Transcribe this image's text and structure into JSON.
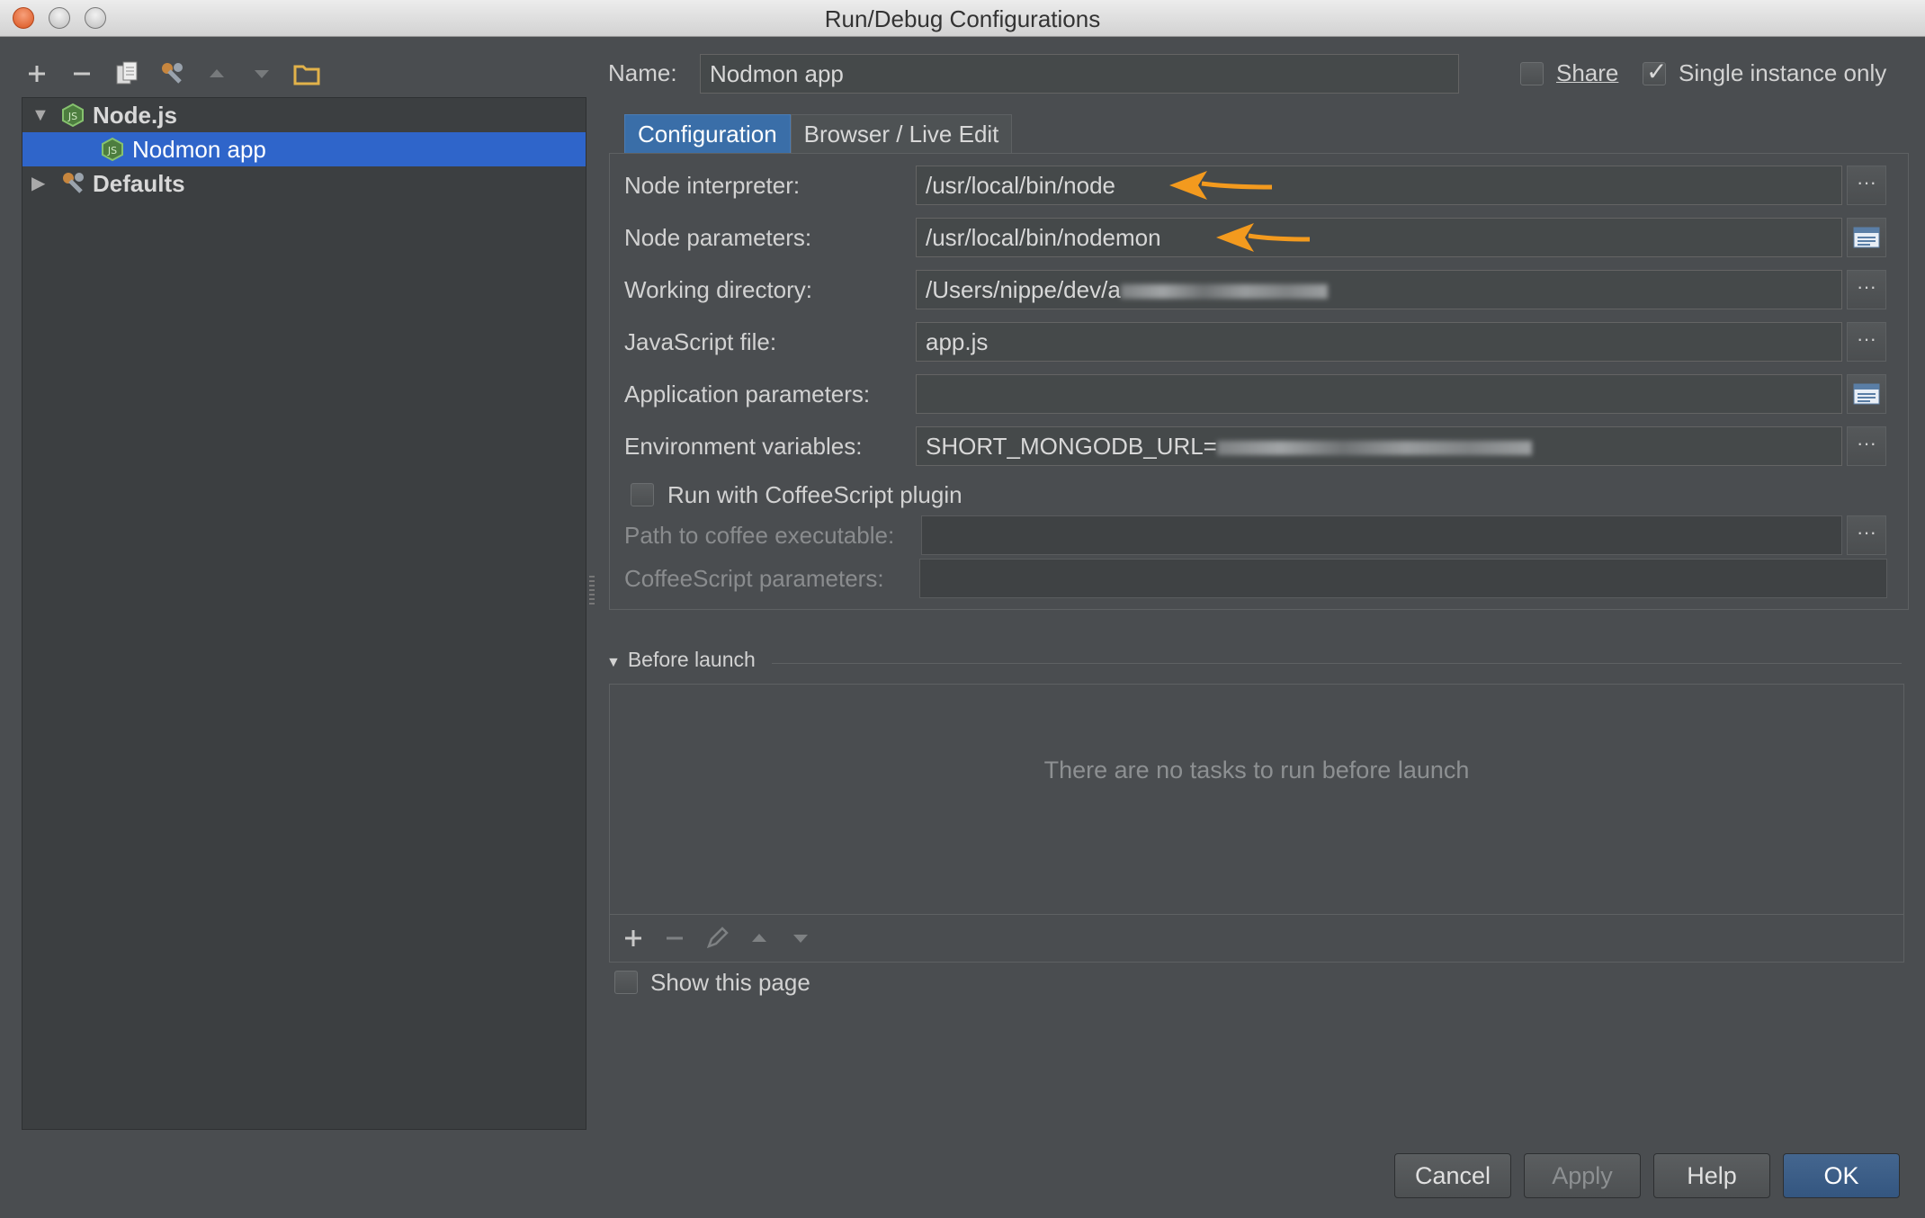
{
  "window": {
    "title": "Run/Debug Configurations"
  },
  "left_toolbar": {
    "icons": [
      "plus-icon",
      "minus-icon",
      "copy-icon",
      "wrench-icon",
      "arrow-up-icon",
      "arrow-down-icon",
      "folder-icon"
    ]
  },
  "tree": {
    "items": [
      {
        "label": "Node.js",
        "expanded": true
      },
      {
        "label": "Nodmon app",
        "selected": true
      },
      {
        "label": "Defaults",
        "expanded": false
      }
    ]
  },
  "header": {
    "name_label": "Name:",
    "name_value": "Nodmon app",
    "share_label": "Share",
    "share_checked": false,
    "single_instance_label": "Single instance only",
    "single_instance_checked": true
  },
  "tabs": [
    {
      "label": "Configuration",
      "active": true
    },
    {
      "label": "Browser / Live Edit",
      "active": false
    }
  ],
  "config": {
    "node_interpreter": {
      "label": "Node interpreter:",
      "value": "/usr/local/bin/node"
    },
    "node_parameters": {
      "label": "Node parameters:",
      "value": "/usr/local/bin/nodemon"
    },
    "working_directory": {
      "label": "Working directory:",
      "value": "/Users/nippe/dev/a"
    },
    "javascript_file": {
      "label": "JavaScript file:",
      "value": "app.js"
    },
    "application_parameters": {
      "label": "Application parameters:",
      "value": ""
    },
    "environment_variables": {
      "label": "Environment variables:",
      "value": "SHORT_MONGODB_URL="
    },
    "coffeescript": {
      "run_with_label": "Run with CoffeeScript plugin",
      "checked": false,
      "path_label": "Path to coffee executable:",
      "path_value": "",
      "params_label": "CoffeeScript parameters:",
      "params_value": ""
    },
    "browse_button": "···"
  },
  "before_launch": {
    "title": "Before launch",
    "empty_text": "There are no tasks to run before launch",
    "tools": [
      "plus-icon",
      "minus-icon",
      "pencil-icon",
      "arrow-up-icon",
      "arrow-down-icon"
    ],
    "show_page_label": "Show this page",
    "show_page_checked": false
  },
  "buttons": {
    "cancel": "Cancel",
    "apply": "Apply",
    "help": "Help",
    "ok": "OK"
  },
  "colors": {
    "selection": "#2f65ca",
    "active_tab": "#3a6ea8",
    "annotation_arrow": "#f39a1e",
    "node_green": "#6da55f"
  }
}
